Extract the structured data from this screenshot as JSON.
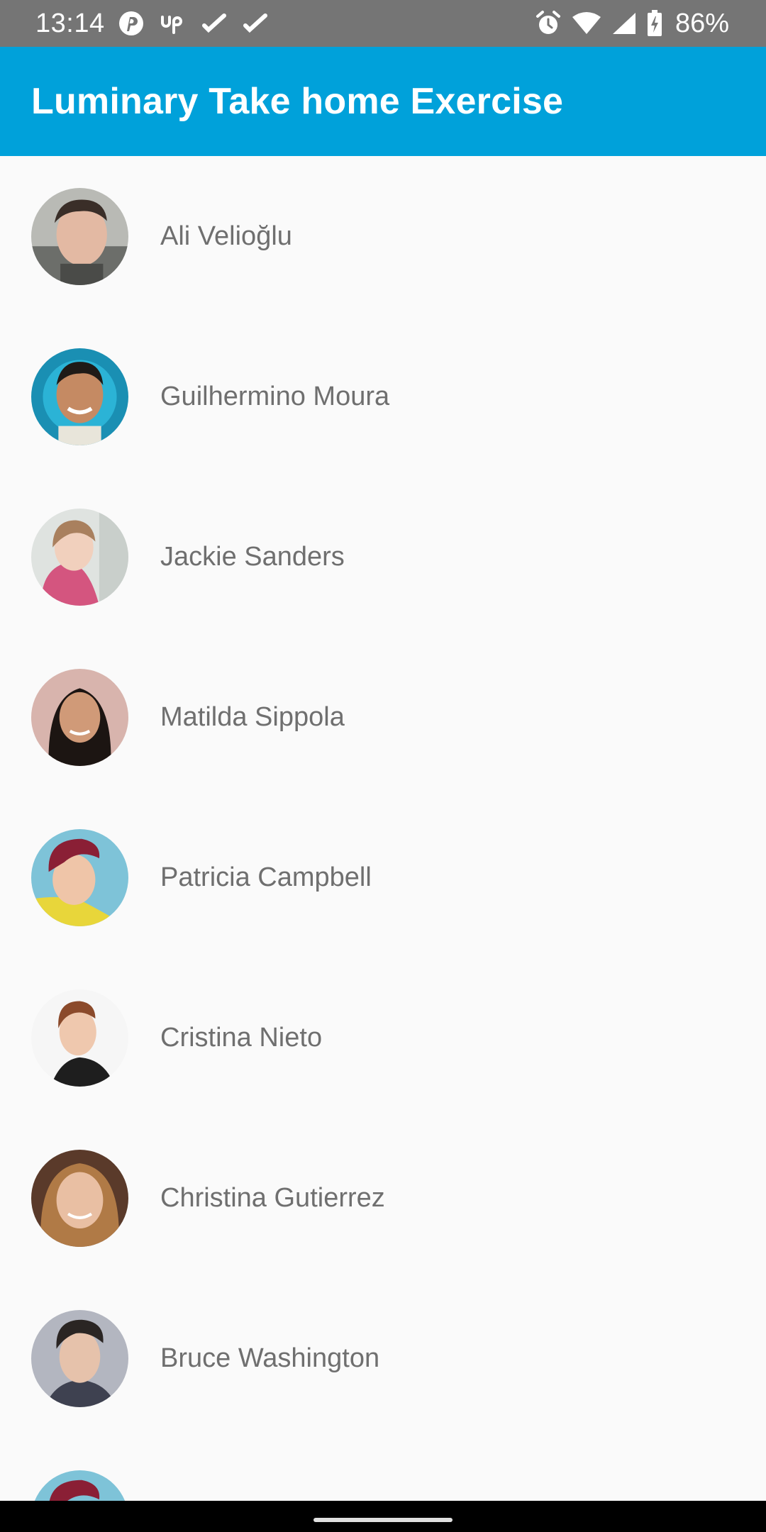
{
  "status_bar": {
    "time": "13:14",
    "battery_text": "86%",
    "left_icons": [
      "pinterest-icon",
      "upwork-icon",
      "check-icon",
      "check-icon"
    ],
    "right_icons": [
      "alarm-icon",
      "wifi-icon",
      "cellular-signal-icon",
      "battery-charging-icon"
    ]
  },
  "app_bar": {
    "title": "Luminary Take home Exercise",
    "color": "#00a1da"
  },
  "contacts": [
    {
      "name": "Ali Velioğlu",
      "avatar": "person-photo"
    },
    {
      "name": "Guilhermino Moura",
      "avatar": "person-photo"
    },
    {
      "name": "Jackie Sanders",
      "avatar": "person-photo"
    },
    {
      "name": "Matilda Sippola",
      "avatar": "person-photo"
    },
    {
      "name": "Patricia Campbell",
      "avatar": "person-photo"
    },
    {
      "name": "Cristina Nieto",
      "avatar": "person-photo"
    },
    {
      "name": "Christina Gutierrez",
      "avatar": "person-photo"
    },
    {
      "name": "Bruce Washington",
      "avatar": "person-photo"
    },
    {
      "name": "",
      "avatar": "person-photo"
    }
  ],
  "colors": {
    "status_bar": "#757575",
    "background": "#fafafa",
    "name_text": "#6f6f6f"
  }
}
